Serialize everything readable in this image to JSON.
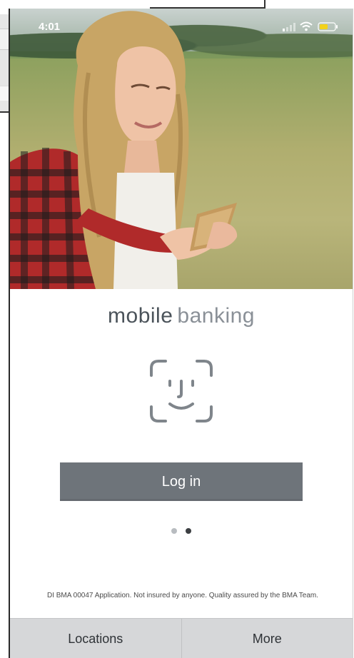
{
  "status_bar": {
    "time": "4:01",
    "icons": [
      "signal-icon",
      "wifi-icon",
      "battery-icon"
    ],
    "battery_color": "#f3d21a"
  },
  "hero": {
    "image": "woman-with-phone-photo"
  },
  "brand": {
    "word1": "mobile",
    "word2": "banking"
  },
  "face_id": {
    "icon": "face-id-icon"
  },
  "login_button": {
    "label": "Log in",
    "color": "#6e747a"
  },
  "page_indicator": {
    "count": 2,
    "active_index": 1
  },
  "disclaimer": "DI BMA 00047 Application. Not insured by anyone. Quality assured by the BMA Team.",
  "tab_bar": {
    "items": [
      {
        "label": "Locations"
      },
      {
        "label": "More"
      }
    ]
  }
}
